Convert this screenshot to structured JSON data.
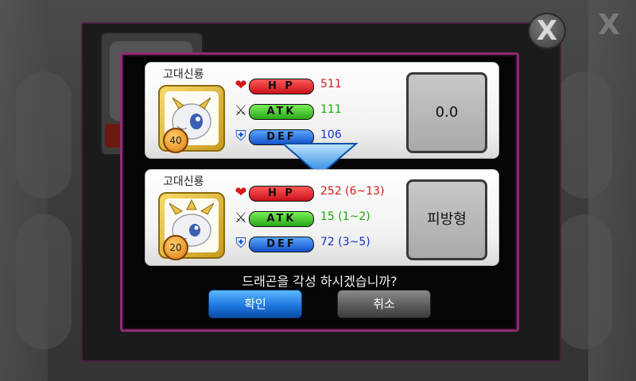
{
  "background": {
    "corner_close_glyph": "X"
  },
  "close_button": {
    "glyph": "X"
  },
  "current": {
    "name": "고대신룡",
    "level": "40",
    "stats": {
      "hp_label": "H P",
      "hp_value": "511",
      "atk_label": "ATK",
      "atk_value": "111",
      "def_label": "DEF",
      "def_value": "106"
    },
    "type_value": "0.0"
  },
  "awakened": {
    "name": "고대신룡",
    "level": "20",
    "stats": {
      "hp_label": "H P",
      "hp_value": "252 (6~13)",
      "atk_label": "ATK",
      "atk_value": "15 (1~2)",
      "def_label": "DEF",
      "def_value": "72 (3~5)"
    },
    "type_value": "피방형"
  },
  "dialog": {
    "question": "드래곤을 각성 하시겠습니까?",
    "confirm_label": "확인",
    "cancel_label": "취소"
  },
  "icons": {
    "hp": "heart-icon",
    "atk": "crossed-swords-icon",
    "def": "shield-icon",
    "arrow": "down-arrow-icon"
  },
  "colors": {
    "hp": "#d41818",
    "atk": "#1aa810",
    "def": "#1634c8",
    "dialog_border": "#8c2d73",
    "confirm_button": "#1e78e0"
  }
}
